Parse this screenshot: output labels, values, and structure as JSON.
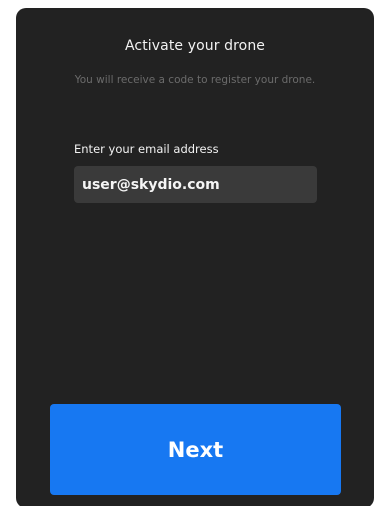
{
  "dialog": {
    "title": "Activate your drone",
    "subtitle": "You will receive a code to register your drone."
  },
  "email": {
    "label": "Enter your email address",
    "value": "user@skydio.com"
  },
  "actions": {
    "next_label": "Next"
  },
  "colors": {
    "card_background": "#222222",
    "input_background": "#3a3a3a",
    "primary_button": "#1778f2",
    "text_primary": "#f2f2f2",
    "text_muted": "#6b6b6b"
  }
}
